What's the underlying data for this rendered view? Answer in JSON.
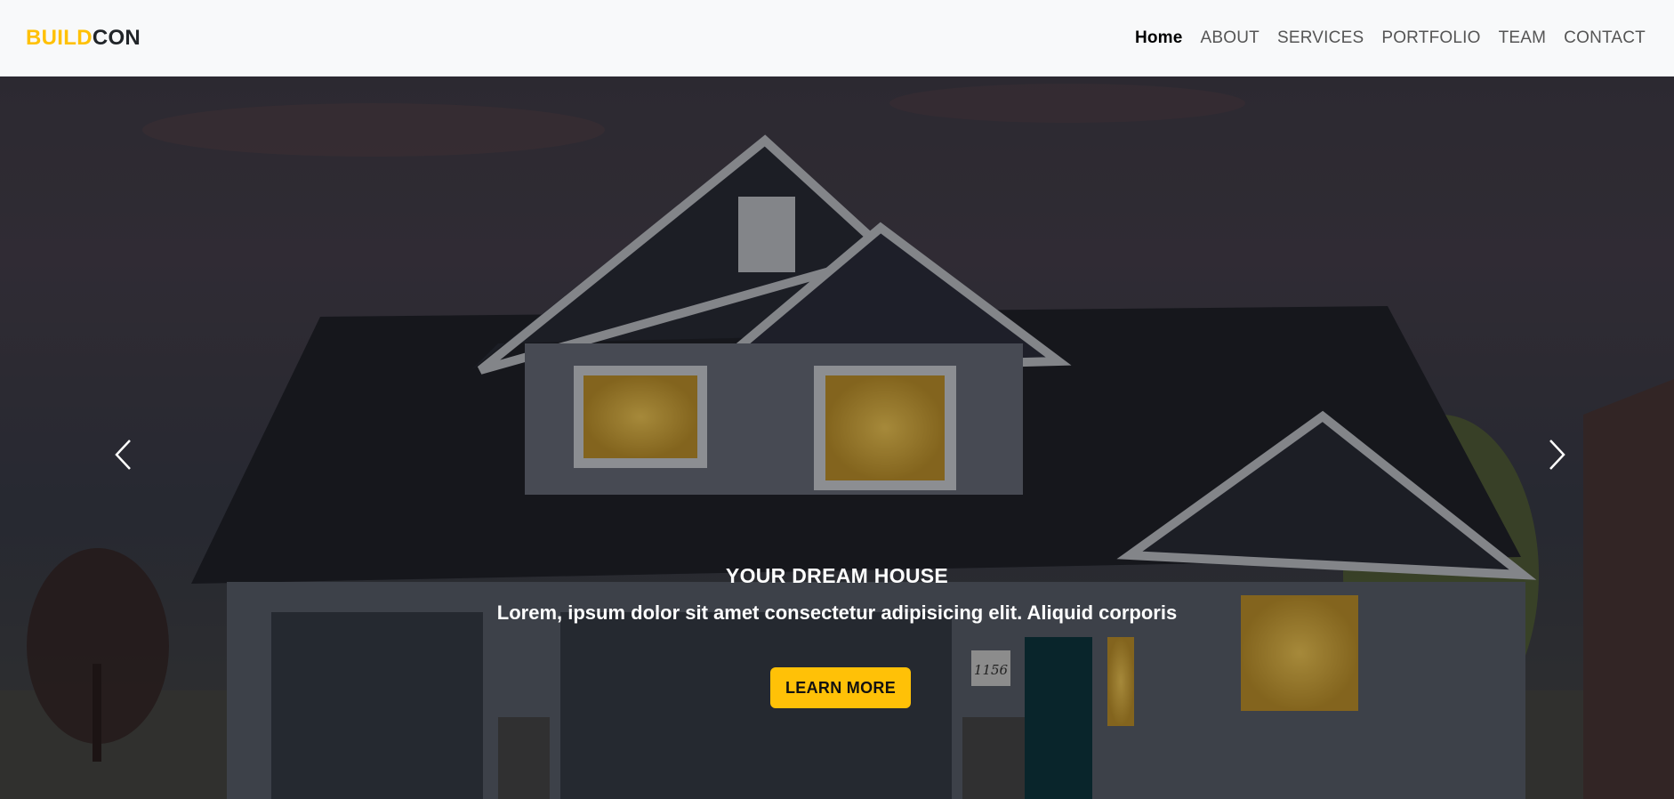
{
  "brand": {
    "part1": "BUILD",
    "part2": "CON"
  },
  "nav": {
    "items": [
      {
        "label": "Home",
        "active": true
      },
      {
        "label": "ABOUT"
      },
      {
        "label": "SERVICES"
      },
      {
        "label": "PORTFOLIO"
      },
      {
        "label": "TEAM"
      },
      {
        "label": "CONTACT"
      }
    ]
  },
  "hero": {
    "title": "YOUR DREAM HOUSE",
    "subtitle": "Lorem, ipsum dolor sit amet consectetur adipisicing elit. Aliquid corporis",
    "button_label": "LEARN MORE",
    "house_number": "1156",
    "prev_icon": "chevron-left-icon",
    "next_icon": "chevron-right-icon"
  },
  "colors": {
    "accent": "#ffc107",
    "nav_bg": "#f8f9fa",
    "text_dark": "#212529"
  }
}
